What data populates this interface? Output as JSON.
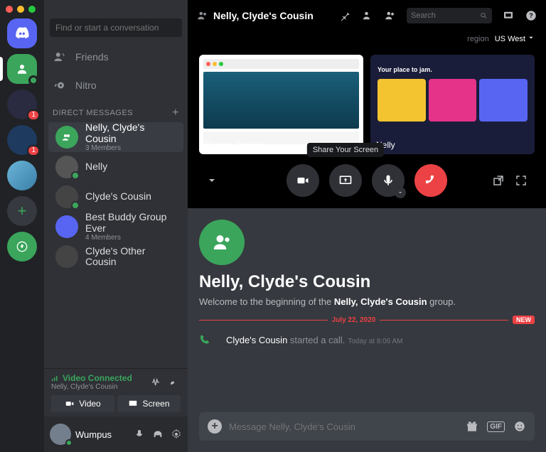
{
  "sidebar_search": {
    "placeholder": "Find or start a conversation"
  },
  "servers": {
    "badge1": "1",
    "badge2": "1"
  },
  "nav": {
    "friends": "Friends",
    "nitro": "Nitro",
    "dm_header": "DIRECT MESSAGES"
  },
  "dms": [
    {
      "name": "Nelly, Clyde's Cousin",
      "sub": "3 Members"
    },
    {
      "name": "Nelly"
    },
    {
      "name": "Clyde's Cousin"
    },
    {
      "name": "Best Buddy Group Ever",
      "sub": "4 Members"
    },
    {
      "name": "Clyde's Other Cousin"
    }
  ],
  "voice": {
    "status": "Video Connected",
    "channel": "Nelly, Clyde's Cousin",
    "video_btn": "Video",
    "screen_btn": "Screen"
  },
  "user": {
    "name": "Wumpus"
  },
  "header": {
    "title": "Nelly, Clyde's Cousin",
    "search_placeholder": "Search",
    "region_label": "region",
    "region_value": "US West"
  },
  "tiles": [
    {
      "name": "Clyde's Cousin"
    },
    {
      "name": "Nelly",
      "banner": "Your place to jam."
    }
  ],
  "tooltip": "Share Your Screen",
  "welcome": {
    "title": "Nelly, Clyde's Cousin",
    "sub_pre": "Welcome to the beginning of the ",
    "sub_bold": "Nelly, Clyde's Cousin",
    "sub_post": " group."
  },
  "divider": {
    "date": "July 22, 2020",
    "new": "NEW"
  },
  "message": {
    "author": "Clyde's Cousin",
    "action": " started a call.",
    "time": "Today at 8:06 AM"
  },
  "composer": {
    "placeholder": "Message Nelly, Clyde's Cousin",
    "gif": "GIF"
  }
}
